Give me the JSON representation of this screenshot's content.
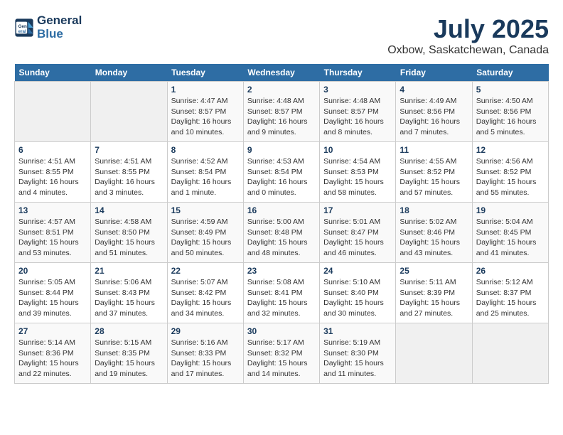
{
  "header": {
    "logo_line1": "General",
    "logo_line2": "Blue",
    "month_title": "July 2025",
    "location": "Oxbow, Saskatchewan, Canada"
  },
  "weekdays": [
    "Sunday",
    "Monday",
    "Tuesday",
    "Wednesday",
    "Thursday",
    "Friday",
    "Saturday"
  ],
  "weeks": [
    [
      {
        "day": "",
        "detail": ""
      },
      {
        "day": "",
        "detail": ""
      },
      {
        "day": "1",
        "detail": "Sunrise: 4:47 AM\nSunset: 8:57 PM\nDaylight: 16 hours and 10 minutes."
      },
      {
        "day": "2",
        "detail": "Sunrise: 4:48 AM\nSunset: 8:57 PM\nDaylight: 16 hours and 9 minutes."
      },
      {
        "day": "3",
        "detail": "Sunrise: 4:48 AM\nSunset: 8:57 PM\nDaylight: 16 hours and 8 minutes."
      },
      {
        "day": "4",
        "detail": "Sunrise: 4:49 AM\nSunset: 8:56 PM\nDaylight: 16 hours and 7 minutes."
      },
      {
        "day": "5",
        "detail": "Sunrise: 4:50 AM\nSunset: 8:56 PM\nDaylight: 16 hours and 5 minutes."
      }
    ],
    [
      {
        "day": "6",
        "detail": "Sunrise: 4:51 AM\nSunset: 8:55 PM\nDaylight: 16 hours and 4 minutes."
      },
      {
        "day": "7",
        "detail": "Sunrise: 4:51 AM\nSunset: 8:55 PM\nDaylight: 16 hours and 3 minutes."
      },
      {
        "day": "8",
        "detail": "Sunrise: 4:52 AM\nSunset: 8:54 PM\nDaylight: 16 hours and 1 minute."
      },
      {
        "day": "9",
        "detail": "Sunrise: 4:53 AM\nSunset: 8:54 PM\nDaylight: 16 hours and 0 minutes."
      },
      {
        "day": "10",
        "detail": "Sunrise: 4:54 AM\nSunset: 8:53 PM\nDaylight: 15 hours and 58 minutes."
      },
      {
        "day": "11",
        "detail": "Sunrise: 4:55 AM\nSunset: 8:52 PM\nDaylight: 15 hours and 57 minutes."
      },
      {
        "day": "12",
        "detail": "Sunrise: 4:56 AM\nSunset: 8:52 PM\nDaylight: 15 hours and 55 minutes."
      }
    ],
    [
      {
        "day": "13",
        "detail": "Sunrise: 4:57 AM\nSunset: 8:51 PM\nDaylight: 15 hours and 53 minutes."
      },
      {
        "day": "14",
        "detail": "Sunrise: 4:58 AM\nSunset: 8:50 PM\nDaylight: 15 hours and 51 minutes."
      },
      {
        "day": "15",
        "detail": "Sunrise: 4:59 AM\nSunset: 8:49 PM\nDaylight: 15 hours and 50 minutes."
      },
      {
        "day": "16",
        "detail": "Sunrise: 5:00 AM\nSunset: 8:48 PM\nDaylight: 15 hours and 48 minutes."
      },
      {
        "day": "17",
        "detail": "Sunrise: 5:01 AM\nSunset: 8:47 PM\nDaylight: 15 hours and 46 minutes."
      },
      {
        "day": "18",
        "detail": "Sunrise: 5:02 AM\nSunset: 8:46 PM\nDaylight: 15 hours and 43 minutes."
      },
      {
        "day": "19",
        "detail": "Sunrise: 5:04 AM\nSunset: 8:45 PM\nDaylight: 15 hours and 41 minutes."
      }
    ],
    [
      {
        "day": "20",
        "detail": "Sunrise: 5:05 AM\nSunset: 8:44 PM\nDaylight: 15 hours and 39 minutes."
      },
      {
        "day": "21",
        "detail": "Sunrise: 5:06 AM\nSunset: 8:43 PM\nDaylight: 15 hours and 37 minutes."
      },
      {
        "day": "22",
        "detail": "Sunrise: 5:07 AM\nSunset: 8:42 PM\nDaylight: 15 hours and 34 minutes."
      },
      {
        "day": "23",
        "detail": "Sunrise: 5:08 AM\nSunset: 8:41 PM\nDaylight: 15 hours and 32 minutes."
      },
      {
        "day": "24",
        "detail": "Sunrise: 5:10 AM\nSunset: 8:40 PM\nDaylight: 15 hours and 30 minutes."
      },
      {
        "day": "25",
        "detail": "Sunrise: 5:11 AM\nSunset: 8:39 PM\nDaylight: 15 hours and 27 minutes."
      },
      {
        "day": "26",
        "detail": "Sunrise: 5:12 AM\nSunset: 8:37 PM\nDaylight: 15 hours and 25 minutes."
      }
    ],
    [
      {
        "day": "27",
        "detail": "Sunrise: 5:14 AM\nSunset: 8:36 PM\nDaylight: 15 hours and 22 minutes."
      },
      {
        "day": "28",
        "detail": "Sunrise: 5:15 AM\nSunset: 8:35 PM\nDaylight: 15 hours and 19 minutes."
      },
      {
        "day": "29",
        "detail": "Sunrise: 5:16 AM\nSunset: 8:33 PM\nDaylight: 15 hours and 17 minutes."
      },
      {
        "day": "30",
        "detail": "Sunrise: 5:17 AM\nSunset: 8:32 PM\nDaylight: 15 hours and 14 minutes."
      },
      {
        "day": "31",
        "detail": "Sunrise: 5:19 AM\nSunset: 8:30 PM\nDaylight: 15 hours and 11 minutes."
      },
      {
        "day": "",
        "detail": ""
      },
      {
        "day": "",
        "detail": ""
      }
    ]
  ]
}
